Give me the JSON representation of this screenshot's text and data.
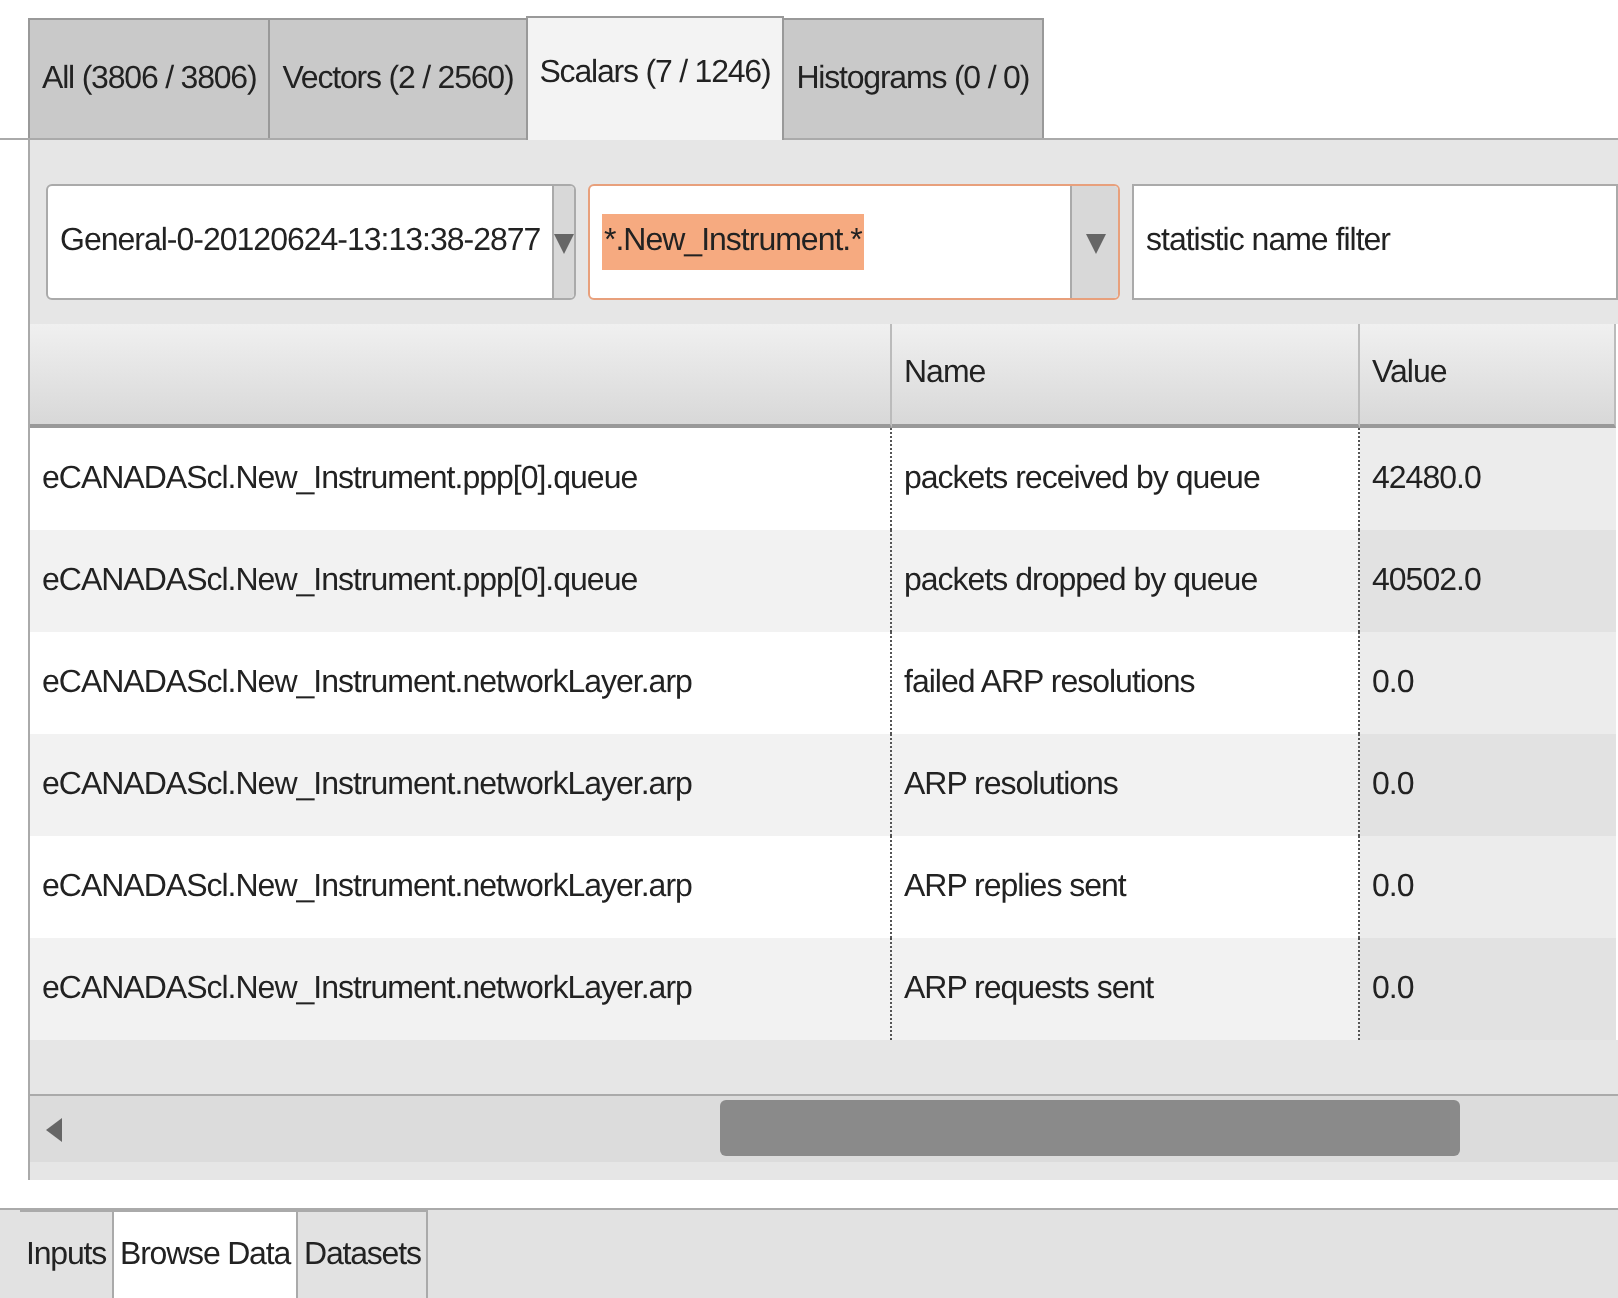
{
  "tabs": [
    {
      "label": "All (3806 / 3806)",
      "selected": false
    },
    {
      "label": "Vectors (2 / 2560)",
      "selected": false
    },
    {
      "label": "Scalars (7 / 1246)",
      "selected": true
    },
    {
      "label": "Histograms (0 / 0)",
      "selected": false
    }
  ],
  "filters": {
    "run": "General-0-20120624-13:13:38-2877",
    "module": "*.New_Instrument.*",
    "module_highlighted": true,
    "statistic_placeholder": "statistic name filter"
  },
  "table": {
    "columns": [
      "",
      "Name",
      "Value"
    ],
    "rows": [
      [
        "eCANADAScl.New_Instrument.ppp[0].queue",
        "packets received by queue",
        "42480.0"
      ],
      [
        "eCANADAScl.New_Instrument.ppp[0].queue",
        "packets dropped by queue",
        "40502.0"
      ],
      [
        "eCANADAScl.New_Instrument.networkLayer.arp",
        "failed ARP resolutions",
        "0.0"
      ],
      [
        "eCANADAScl.New_Instrument.networkLayer.arp",
        "ARP resolutions",
        "0.0"
      ],
      [
        "eCANADAScl.New_Instrument.networkLayer.arp",
        "ARP replies sent",
        "0.0"
      ],
      [
        "eCANADAScl.New_Instrument.networkLayer.arp",
        "ARP requests sent",
        "0.0"
      ]
    ]
  },
  "bottom_tabs": [
    {
      "label": "Inputs",
      "selected": false
    },
    {
      "label": "Browse Data",
      "selected": true
    },
    {
      "label": "Datasets",
      "selected": false
    }
  ]
}
